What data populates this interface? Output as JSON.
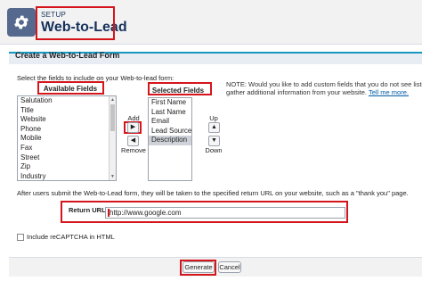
{
  "header": {
    "setup_label": "SETUP",
    "title": "Web-to-Lead",
    "icon": "gear-icon"
  },
  "section": {
    "title": "Create a Web-to-Lead Form",
    "instructions": "Select the fields to include on your Web-to-lead form:",
    "note_line1": "NOTE: Would you like to add custom fields that you do not see listed o",
    "note_line2_text": "gather additional information from your website.",
    "note_link": "Tell me more."
  },
  "available": {
    "header": "Available Fields",
    "options": [
      "Salutation",
      "Title",
      "Website",
      "Phone",
      "Mobile",
      "Fax",
      "Street",
      "Zip",
      "Industry"
    ]
  },
  "selected": {
    "header": "Selected Fields",
    "options": [
      "First Name",
      "Last Name",
      "Email",
      "Lead Source",
      "Description"
    ],
    "highlighted_option": "Description"
  },
  "controls": {
    "add_label": "Add",
    "remove_label": "Remove",
    "up_label": "Up",
    "down_label": "Down",
    "right_arrow": "▶",
    "left_arrow": "◀",
    "up_arrow": "▲",
    "down_arrow": "▼"
  },
  "return_url": {
    "description": "After users submit the Web-to-Lead form, they will be taken to the specified return URL on your website, such as a \"thank you\" page.",
    "label": "Return URL",
    "value": "http://www.google.com"
  },
  "recaptcha": {
    "label": "Include reCAPTCHA in HTML",
    "checked": false
  },
  "buttons": {
    "generate": "Generate",
    "cancel": "Cancel"
  },
  "colors": {
    "highlight": "#d4161c",
    "header_bg": "#f3f2f2",
    "accent": "#1797c0",
    "icon_tile": "#54698d"
  }
}
